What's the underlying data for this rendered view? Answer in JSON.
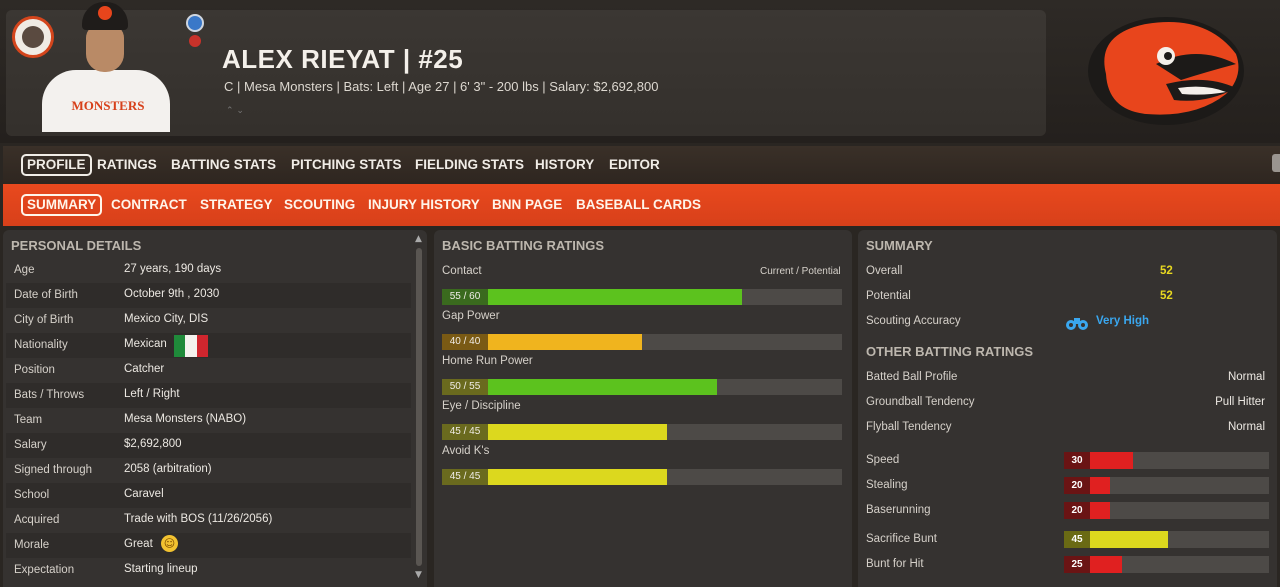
{
  "header": {
    "name_line": "ALEX RIEYAT  |  #25",
    "info_line": "C | Mesa Monsters  |  Bats: Left  |  Age 27  |  6' 3\" - 200 lbs  |  Salary: $2,692,800",
    "jersey_text": "MONSTERS",
    "badge_icon": "team-badge-icon",
    "logo_icon": "monster-logo-icon"
  },
  "main_nav": [
    "PROFILE",
    "RATINGS",
    "BATTING STATS",
    "PITCHING STATS",
    "FIELDING STATS",
    "HISTORY",
    "EDITOR"
  ],
  "sub_nav": [
    "SUMMARY",
    "CONTRACT",
    "STRATEGY",
    "SCOUTING",
    "INJURY HISTORY",
    "BNN PAGE",
    "BASEBALL CARDS"
  ],
  "personal": {
    "title": "PERSONAL DETAILS",
    "rows": [
      {
        "label": "Age",
        "value": "27 years, 190 days"
      },
      {
        "label": "Date of Birth",
        "value": "October 9th , 2030"
      },
      {
        "label": "City of Birth",
        "value": "Mexico City, DIS"
      },
      {
        "label": "Nationality",
        "value": "Mexican"
      },
      {
        "label": "Position",
        "value": "Catcher"
      },
      {
        "label": "Bats / Throws",
        "value": "Left / Right"
      },
      {
        "label": "Team",
        "value": "Mesa Monsters (NABO)"
      },
      {
        "label": "Salary",
        "value": "$2,692,800"
      },
      {
        "label": "Signed through",
        "value": "2058 (arbitration)"
      },
      {
        "label": "School",
        "value": "Caravel"
      },
      {
        "label": "Acquired",
        "value": "Trade with BOS (11/26/2056)"
      },
      {
        "label": "Morale",
        "value": "Great"
      },
      {
        "label": "Expectation",
        "value": "Starting lineup"
      }
    ]
  },
  "batting": {
    "title": "BASIC BATTING RATINGS",
    "header_right": "Current / Potential",
    "ratings": [
      {
        "label": "Contact",
        "text": "55 / 60",
        "current": 55,
        "potential": 60
      },
      {
        "label": "Gap Power",
        "text": "40 / 40",
        "current": 40,
        "potential": 40
      },
      {
        "label": "Home Run Power",
        "text": "50 / 55",
        "current": 50,
        "potential": 55
      },
      {
        "label": "Eye / Discipline",
        "text": "45 / 45",
        "current": 45,
        "potential": 45
      },
      {
        "label": "Avoid K's",
        "text": "45 / 45",
        "current": 45,
        "potential": 45
      }
    ]
  },
  "summary": {
    "title": "SUMMARY",
    "overall_label": "Overall",
    "overall": "52",
    "potential_label": "Potential",
    "potential": "52",
    "scouting_label": "Scouting Accuracy",
    "scouting": "Very High",
    "other_title": "OTHER BATTING RATINGS",
    "other": [
      {
        "label": "Batted Ball Profile",
        "value": "Normal"
      },
      {
        "label": "Groundball Tendency",
        "value": "Pull Hitter"
      },
      {
        "label": "Flyball Tendency",
        "value": "Normal"
      }
    ],
    "speed": [
      {
        "label": "Speed",
        "value": "30",
        "level": 30
      },
      {
        "label": "Stealing",
        "value": "20",
        "level": 20
      },
      {
        "label": "Baserunning",
        "value": "20",
        "level": 20
      },
      {
        "label": "Sacrifice Bunt",
        "value": "45",
        "level": 45
      },
      {
        "label": "Bunt for Hit",
        "value": "25",
        "level": 25
      }
    ]
  },
  "colors": {
    "accent": "#e8491e",
    "green": "#5cc21e",
    "yellow": "#dcd81e",
    "orange": "#f0b41e",
    "red": "#e02020",
    "link_blue": "#3aa7ef"
  }
}
